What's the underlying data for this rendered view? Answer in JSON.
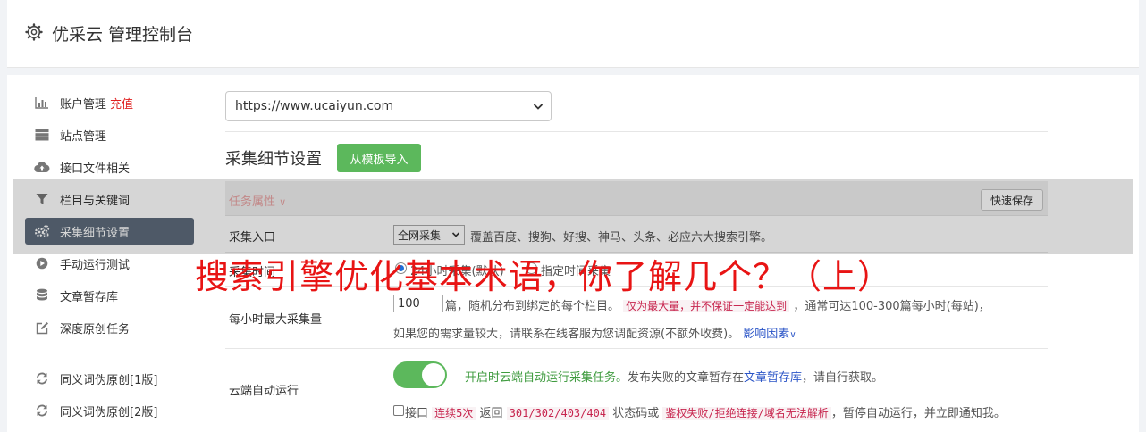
{
  "header": {
    "title": "优采云 管理控制台",
    "icon": "gear-icon"
  },
  "sidebar": {
    "items": [
      {
        "label": "账户管理",
        "badge": "充值",
        "icon": "bar-chart-icon"
      },
      {
        "label": "站点管理",
        "icon": "server-icon"
      },
      {
        "label": "接口文件相关",
        "icon": "cloud-upload-icon"
      },
      {
        "label": "栏目与关键词",
        "icon": "filter-icon"
      },
      {
        "label": "采集细节设置",
        "icon": "gears-icon",
        "active": true
      },
      {
        "label": "手动运行测试",
        "icon": "play-icon"
      },
      {
        "label": "文章暂存库",
        "icon": "database-icon"
      },
      {
        "label": "深度原创任务",
        "icon": "edit-icon"
      },
      {
        "label": "同义词伪原创[1版]",
        "icon": "refresh-icon"
      },
      {
        "label": "同义词伪原创[2版]",
        "icon": "refresh-icon"
      }
    ]
  },
  "site_select": {
    "value": "https://www.ucaiyun.com"
  },
  "section": {
    "title": "采集细节设置",
    "import_button": "从模板导入"
  },
  "task_bar": {
    "label": "任务属性",
    "save_button": "快速保存"
  },
  "entry_row": {
    "label": "采集入口",
    "select_value": "全网采集",
    "note": "覆盖百度、搜狗、好搜、神马、头条、必应六大搜索引擎。"
  },
  "time_row": {
    "label": "采集时间",
    "option_1": "24小时采集(默认)",
    "option_2": "指定时间采集"
  },
  "max_row": {
    "label": "每小时最大采集量",
    "value": "100",
    "note_a": "篇，随机分布到绑定的每个栏目。",
    "note_hl": "仅为最大量，并不保证一定能达到",
    "note_b": "，通常可达100-300篇每小时(每站)，",
    "note_c": "如果您的需求量较大，请联系在线客服为您调配资源(不额外收费)。",
    "note_link": "影响因素"
  },
  "cloud_row": {
    "label": "云端自动运行",
    "toggle_on": true,
    "note_green": "开启时云端自动运行采集任务。",
    "note_a": "发布失败的文章暂存在",
    "note_link": "文章暂存库",
    "note_b": "，请自行获取。",
    "check_a": "接口",
    "check_hl1": "连续5次",
    "check_b": "返回",
    "check_hl2": "301/302/403/404",
    "check_c": "状态码或",
    "check_hl3": "鉴权失败/拒绝连接/域名无法解析",
    "check_d": "，暂停自动运行，并立即通知我。"
  },
  "banner": {
    "text": "搜索引擎优化基本术语，你了解几个？（上）"
  },
  "colors": {
    "accent_green": "#5cb85c",
    "active_nav": "#5d6a7b",
    "banner_red": "#e81414",
    "charge_red": "#e02020"
  }
}
